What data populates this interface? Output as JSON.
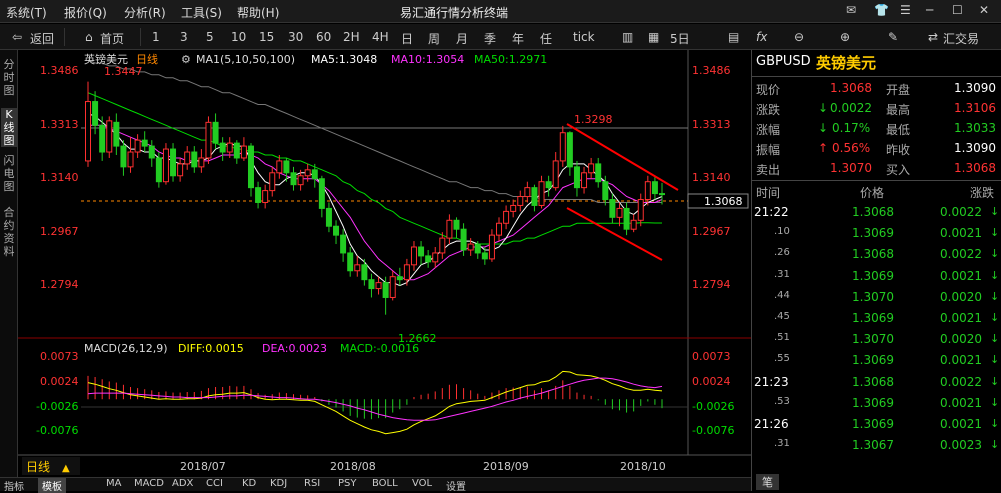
{
  "menu": [
    "系统(T)",
    "报价(Q)",
    "分析(R)",
    "工具(S)",
    "帮助(H)"
  ],
  "window_title": "易汇通行情分析终端",
  "toolbar": {
    "back": "返回",
    "home": "首页",
    "periods": [
      "1",
      "3",
      "5",
      "10",
      "15",
      "30",
      "60",
      "2H",
      "4H",
      "日",
      "周",
      "月",
      "季",
      "年",
      "任",
      "tick"
    ],
    "five_day": "5日",
    "fx": "fx",
    "trade": "汇交易"
  },
  "left_tabs": [
    "分时图",
    "K线图",
    "闪电图",
    "合约资料"
  ],
  "main_legend": {
    "name": "英镑美元",
    "period": "日线",
    "ma_params": "MA1(5,10,50,100)",
    "ma5": "MA5:1.3048",
    "ma10": "MA10:1.3054",
    "ma50": "MA50:1.2971"
  },
  "price_axis": [
    "1.3486",
    "1.3313",
    "1.3140",
    "1.2967",
    "1.2794"
  ],
  "current_price_tag": "1.3068",
  "annotations": {
    "high": "1.3447",
    "low": "1.2662",
    "swing": "1.3298"
  },
  "macd_legend": {
    "name": "MACD(26,12,9)",
    "diff": "DIFF:0.0015",
    "dea": "DEA:0.0023",
    "macd": "MACD:-0.0016"
  },
  "macd_axis": [
    "0.0073",
    "0.0024",
    "-0.0026",
    "-0.0076"
  ],
  "x_labels": [
    "2018/07",
    "2018/08",
    "2018/09",
    "2018/10"
  ],
  "period_badge": "日线",
  "bottom_tabs": [
    "指标",
    "模板",
    "MA",
    "MACD",
    "ADX",
    "CCI",
    "KD",
    "KDJ",
    "RSI",
    "PSY",
    "BOLL",
    "VOL",
    "设置"
  ],
  "colors": {
    "up": "#ff3030",
    "down": "#22cc22",
    "ma5": "#ffffff",
    "ma10": "#ff33ff",
    "ma50": "#00dd00",
    "ma100": "#777777",
    "trend": "#ff0000",
    "price_text": "#ff3333"
  },
  "quote": {
    "symbol": "GBPUSD",
    "name_cn": "英镑美元",
    "rows": [
      {
        "l1": "现价",
        "v1": "1.3068",
        "l2": "开盘",
        "v2": "1.3090"
      },
      {
        "l1": "涨跌",
        "v1": "0.0022",
        "l2": "最高",
        "v2": "1.3106"
      },
      {
        "l1": "涨幅",
        "v1": "0.17%",
        "l2": "最低",
        "v2": "1.3033"
      },
      {
        "l1": "振幅",
        "v1": "0.56%",
        "l2": "昨收",
        "v2": "1.3090"
      },
      {
        "l1": "卖出",
        "v1": "1.3070",
        "l2": "买入",
        "v2": "1.3068"
      }
    ],
    "tick_headers": [
      "时间",
      "价格",
      "涨跌"
    ],
    "ticks": [
      {
        "t": "21:22",
        "p": "1.3068",
        "c": "0.0022"
      },
      {
        "t": ".10",
        "p": "1.3069",
        "c": "0.0021"
      },
      {
        "t": ".26",
        "p": "1.3068",
        "c": "0.0022"
      },
      {
        "t": ".31",
        "p": "1.3069",
        "c": "0.0021"
      },
      {
        "t": ".44",
        "p": "1.3070",
        "c": "0.0020"
      },
      {
        "t": ".45",
        "p": "1.3069",
        "c": "0.0021"
      },
      {
        "t": ".51",
        "p": "1.3070",
        "c": "0.0020"
      },
      {
        "t": ".55",
        "p": "1.3069",
        "c": "0.0021"
      },
      {
        "t": "21:23",
        "p": "1.3068",
        "c": "0.0022"
      },
      {
        "t": ".53",
        "p": "1.3069",
        "c": "0.0021"
      },
      {
        "t": "21:26",
        "p": "1.3069",
        "c": "0.0021"
      },
      {
        "t": ".31",
        "p": "1.3067",
        "c": "0.0023"
      }
    ],
    "footer": "笔"
  },
  "chart_data": {
    "type": "candlestick",
    "instrument": "GBPUSD 英镑美元",
    "period": "日线",
    "x_ticks": [
      "2018/07",
      "2018/08",
      "2018/09",
      "2018/10"
    ],
    "y_ticks": [
      1.2794,
      1.2967,
      1.314,
      1.3313,
      1.3486
    ],
    "ylim": [
      1.257,
      1.352
    ],
    "current_price": 1.3068,
    "high_marker": 1.3447,
    "low_marker": 1.2662,
    "swing_high_marker": 1.3298,
    "candles": [
      [
        1.318,
        1.338,
        1.3447,
        1.316
      ],
      [
        1.338,
        1.33,
        1.3415,
        1.327
      ],
      [
        1.33,
        1.321,
        1.333,
        1.318
      ],
      [
        1.321,
        1.3315,
        1.333,
        1.319
      ],
      [
        1.331,
        1.323,
        1.334,
        1.32
      ],
      [
        1.323,
        1.316,
        1.325,
        1.313
      ],
      [
        1.316,
        1.321,
        1.326,
        1.314
      ],
      [
        1.321,
        1.325,
        1.327,
        1.319
      ],
      [
        1.325,
        1.323,
        1.328,
        1.321
      ],
      [
        1.323,
        1.319,
        1.325,
        1.316
      ],
      [
        1.319,
        1.311,
        1.321,
        1.309
      ],
      [
        1.311,
        1.322,
        1.324,
        1.31
      ],
      [
        1.322,
        1.313,
        1.324,
        1.311
      ],
      [
        1.313,
        1.317,
        1.319,
        1.311
      ],
      [
        1.317,
        1.321,
        1.323,
        1.315
      ],
      [
        1.321,
        1.316,
        1.323,
        1.314
      ],
      [
        1.316,
        1.319,
        1.322,
        1.314
      ],
      [
        1.319,
        1.331,
        1.333,
        1.317
      ],
      [
        1.331,
        1.324,
        1.334,
        1.322
      ],
      [
        1.324,
        1.321,
        1.326,
        1.318
      ],
      [
        1.321,
        1.324,
        1.326,
        1.319
      ],
      [
        1.324,
        1.319,
        1.325,
        1.317
      ],
      [
        1.319,
        1.323,
        1.326,
        1.318
      ],
      [
        1.323,
        1.309,
        1.324,
        1.306
      ],
      [
        1.309,
        1.304,
        1.311,
        1.302
      ],
      [
        1.304,
        1.308,
        1.31,
        1.302
      ],
      [
        1.308,
        1.314,
        1.316,
        1.306
      ],
      [
        1.314,
        1.318,
        1.32,
        1.312
      ],
      [
        1.318,
        1.314,
        1.319,
        1.311
      ],
      [
        1.314,
        1.31,
        1.316,
        1.308
      ],
      [
        1.31,
        1.313,
        1.315,
        1.308
      ],
      [
        1.313,
        1.315,
        1.317,
        1.311
      ],
      [
        1.315,
        1.312,
        1.317,
        1.309
      ],
      [
        1.312,
        1.302,
        1.313,
        1.299
      ],
      [
        1.302,
        1.296,
        1.304,
        1.294
      ],
      [
        1.296,
        1.293,
        1.298,
        1.29
      ],
      [
        1.293,
        1.287,
        1.295,
        1.284
      ],
      [
        1.287,
        1.281,
        1.289,
        1.279
      ],
      [
        1.281,
        1.283,
        1.286,
        1.279
      ],
      [
        1.283,
        1.278,
        1.285,
        1.276
      ],
      [
        1.278,
        1.275,
        1.28,
        1.272
      ],
      [
        1.275,
        1.277,
        1.279,
        1.273
      ],
      [
        1.277,
        1.272,
        1.279,
        1.2662
      ],
      [
        1.272,
        1.279,
        1.281,
        1.271
      ],
      [
        1.279,
        1.278,
        1.282,
        1.276
      ],
      [
        1.278,
        1.283,
        1.285,
        1.276
      ],
      [
        1.283,
        1.289,
        1.291,
        1.281
      ],
      [
        1.289,
        1.286,
        1.291,
        1.283
      ],
      [
        1.286,
        1.284,
        1.288,
        1.282
      ],
      [
        1.284,
        1.287,
        1.289,
        1.282
      ],
      [
        1.287,
        1.292,
        1.294,
        1.285
      ],
      [
        1.292,
        1.298,
        1.3,
        1.29
      ],
      [
        1.298,
        1.295,
        1.299,
        1.292
      ],
      [
        1.295,
        1.288,
        1.297,
        1.286
      ],
      [
        1.288,
        1.29,
        1.292,
        1.286
      ],
      [
        1.29,
        1.287,
        1.291,
        1.285
      ],
      [
        1.287,
        1.285,
        1.289,
        1.283
      ],
      [
        1.285,
        1.293,
        1.295,
        1.284
      ],
      [
        1.293,
        1.297,
        1.299,
        1.291
      ],
      [
        1.297,
        1.301,
        1.303,
        1.295
      ],
      [
        1.301,
        1.303,
        1.305,
        1.299
      ],
      [
        1.303,
        1.306,
        1.308,
        1.301
      ],
      [
        1.306,
        1.309,
        1.311,
        1.304
      ],
      [
        1.309,
        1.303,
        1.31,
        1.301
      ],
      [
        1.303,
        1.311,
        1.313,
        1.302
      ],
      [
        1.311,
        1.309,
        1.313,
        1.306
      ],
      [
        1.309,
        1.318,
        1.321,
        1.308
      ],
      [
        1.318,
        1.3275,
        1.3298,
        1.316
      ],
      [
        1.3275,
        1.316,
        1.328,
        1.313
      ],
      [
        1.316,
        1.309,
        1.318,
        1.306
      ],
      [
        1.309,
        1.314,
        1.316,
        1.307
      ],
      [
        1.314,
        1.317,
        1.319,
        1.312
      ],
      [
        1.317,
        1.311,
        1.319,
        1.309
      ],
      [
        1.311,
        1.305,
        1.313,
        1.303
      ],
      [
        1.305,
        1.299,
        1.307,
        1.297
      ],
      [
        1.299,
        1.302,
        1.304,
        1.296
      ],
      [
        1.302,
        1.295,
        1.304,
        1.293
      ],
      [
        1.295,
        1.298,
        1.3,
        1.294
      ],
      [
        1.298,
        1.305,
        1.307,
        1.296
      ],
      [
        1.305,
        1.311,
        1.313,
        1.303
      ],
      [
        1.311,
        1.307,
        1.313,
        1.305
      ],
      [
        1.307,
        1.3068,
        1.3106,
        1.3033
      ]
    ],
    "ma5": [
      1.334,
      1.333,
      1.331,
      1.329,
      1.327,
      1.324,
      1.322,
      1.322,
      1.321,
      1.321,
      1.319,
      1.319,
      1.318,
      1.317,
      1.317,
      1.318,
      1.318,
      1.319,
      1.322,
      1.323,
      1.324,
      1.323,
      1.323,
      1.318,
      1.314,
      1.311,
      1.31,
      1.31,
      1.312,
      1.313,
      1.314,
      1.314,
      1.313,
      1.31,
      1.306,
      1.301,
      1.296,
      1.29,
      1.286,
      1.284,
      1.281,
      1.279,
      1.277,
      1.277,
      1.276,
      1.277,
      1.28,
      1.283,
      1.284,
      1.286,
      1.288,
      1.29,
      1.291,
      1.291,
      1.291,
      1.29,
      1.288,
      1.288,
      1.289,
      1.292,
      1.296,
      1.3,
      1.303,
      1.305,
      1.307,
      1.308,
      1.311,
      1.315,
      1.317,
      1.317,
      1.317,
      1.315,
      1.313,
      1.311,
      1.307,
      1.304,
      1.301,
      1.3,
      1.302,
      1.304,
      1.305,
      1.306
    ],
    "ma10": [
      1.33,
      1.33,
      1.33,
      1.329,
      1.328,
      1.327,
      1.326,
      1.325,
      1.324,
      1.323,
      1.321,
      1.32,
      1.319,
      1.319,
      1.318,
      1.318,
      1.318,
      1.318,
      1.319,
      1.32,
      1.32,
      1.32,
      1.321,
      1.32,
      1.319,
      1.317,
      1.316,
      1.314,
      1.313,
      1.312,
      1.312,
      1.312,
      1.312,
      1.31,
      1.308,
      1.305,
      1.302,
      1.299,
      1.295,
      1.291,
      1.288,
      1.285,
      1.283,
      1.281,
      1.279,
      1.278,
      1.278,
      1.279,
      1.28,
      1.282,
      1.284,
      1.286,
      1.287,
      1.288,
      1.289,
      1.289,
      1.289,
      1.29,
      1.291,
      1.292,
      1.293,
      1.295,
      1.297,
      1.299,
      1.301,
      1.303,
      1.306,
      1.309,
      1.31,
      1.311,
      1.312,
      1.312,
      1.312,
      1.311,
      1.31,
      1.308,
      1.306,
      1.305,
      1.304,
      1.304,
      1.304,
      1.305
    ],
    "ma50": [
      1.341,
      1.34,
      1.339,
      1.338,
      1.337,
      1.336,
      1.335,
      1.334,
      1.333,
      1.332,
      1.331,
      1.33,
      1.329,
      1.328,
      1.327,
      1.326,
      1.325,
      1.325,
      1.324,
      1.323,
      1.323,
      1.322,
      1.322,
      1.321,
      1.321,
      1.32,
      1.32,
      1.319,
      1.319,
      1.318,
      1.318,
      1.317,
      1.316,
      1.315,
      1.314,
      1.313,
      1.311,
      1.31,
      1.308,
      1.307,
      1.305,
      1.304,
      1.302,
      1.301,
      1.299,
      1.298,
      1.297,
      1.296,
      1.295,
      1.294,
      1.293,
      1.292,
      1.292,
      1.291,
      1.291,
      1.29,
      1.29,
      1.29,
      1.29,
      1.29,
      1.291,
      1.291,
      1.292,
      1.292,
      1.293,
      1.294,
      1.295,
      1.296,
      1.296,
      1.297,
      1.297,
      1.297,
      1.297,
      1.297,
      1.297,
      1.297,
      1.297,
      1.297,
      1.2972,
      1.2972,
      1.2971,
      1.2971
    ],
    "ma100": [
      1.352,
      1.351,
      1.351,
      1.35,
      1.35,
      1.349,
      1.349,
      1.348,
      1.348,
      1.347,
      1.347,
      1.346,
      1.346,
      1.345,
      1.345,
      1.344,
      1.343,
      1.343,
      1.342,
      1.341,
      1.341,
      1.34,
      1.339,
      1.338,
      1.337,
      1.337,
      1.336,
      1.335,
      1.334,
      1.333,
      1.332,
      1.331,
      1.33,
      1.329,
      1.328,
      1.327,
      1.326,
      1.325,
      1.324,
      1.323,
      1.322,
      1.321,
      1.32,
      1.319,
      1.318,
      1.317,
      1.316,
      1.315,
      1.314,
      1.313,
      1.312,
      1.311,
      1.311,
      1.31,
      1.309,
      1.309,
      1.308,
      1.308,
      1.307,
      1.307,
      1.306,
      1.306,
      1.306,
      1.306,
      1.305,
      1.305,
      1.305,
      1.305,
      1.305,
      1.305,
      1.305,
      1.305,
      1.304,
      1.304,
      1.304,
      1.304,
      1.304,
      1.304,
      1.304,
      1.304,
      1.304,
      1.304
    ],
    "macd_ylim": [
      -0.0095,
      0.0085
    ],
    "macd_hist": [
      0.0042,
      0.004,
      0.0036,
      0.0032,
      0.003,
      0.0026,
      0.0022,
      0.002,
      0.0018,
      0.0016,
      0.0013,
      0.0014,
      0.0012,
      0.0012,
      0.0013,
      0.0013,
      0.0015,
      0.002,
      0.0022,
      0.0022,
      0.0024,
      0.0023,
      0.0024,
      0.0018,
      0.0011,
      0.0008,
      0.0009,
      0.0012,
      0.0011,
      0.0009,
      0.0008,
      0.0007,
      0.0004,
      -0.0004,
      -0.001,
      -0.0015,
      -0.0022,
      -0.003,
      -0.0033,
      -0.0035,
      -0.0036,
      -0.0034,
      -0.0034,
      -0.0024,
      -0.0018,
      -0.001,
      0.0004,
      0.0008,
      0.001,
      0.0014,
      0.002,
      0.0026,
      0.0027,
      0.002,
      0.0016,
      0.001,
      0.0006,
      0.0012,
      0.0016,
      0.002,
      0.0021,
      0.0022,
      0.0023,
      0.0016,
      0.002,
      0.0016,
      0.0024,
      0.0034,
      0.0024,
      0.0012,
      0.0008,
      0.0006,
      -0.0002,
      -0.001,
      -0.0018,
      -0.002,
      -0.0024,
      -0.0022,
      -0.0012,
      -0.0004,
      -0.001,
      -0.0016
    ],
    "diff": [
      0.003,
      0.0027,
      0.0023,
      0.0019,
      0.0016,
      0.0012,
      0.0008,
      0.0006,
      0.0004,
      0.0002,
      0.0,
      0.0001,
      0.0,
      0.0,
      0.0001,
      0.0001,
      0.0002,
      0.0006,
      0.0008,
      0.0009,
      0.0011,
      0.0011,
      0.0012,
      0.0008,
      0.0003,
      0.0,
      -0.0001,
      0.0,
      0.0,
      -0.0001,
      -0.0002,
      -0.0002,
      -0.0004,
      -0.001,
      -0.0016,
      -0.0022,
      -0.003,
      -0.0038,
      -0.0044,
      -0.005,
      -0.0055,
      -0.0058,
      -0.0062,
      -0.006,
      -0.0058,
      -0.0054,
      -0.0046,
      -0.004,
      -0.0035,
      -0.003,
      -0.0022,
      -0.0013,
      -0.0008,
      -0.0006,
      -0.0004,
      -0.0003,
      -0.0002,
      0.0003,
      0.0008,
      0.0013,
      0.0017,
      0.0021,
      0.0025,
      0.0026,
      0.0031,
      0.0033,
      0.004,
      0.005,
      0.0049,
      0.0044,
      0.0043,
      0.0042,
      0.0039,
      0.0034,
      0.0028,
      0.0024,
      0.0019,
      0.0016,
      0.0016,
      0.0018,
      0.0016,
      0.0015
    ],
    "dea": [
      0.001,
      0.0011,
      0.0011,
      0.0011,
      0.0011,
      0.0011,
      0.001,
      0.0009,
      0.0008,
      0.0007,
      0.0006,
      0.0005,
      0.0004,
      0.0004,
      0.0003,
      0.0003,
      0.0003,
      0.0003,
      0.0004,
      0.0005,
      0.0006,
      0.0006,
      0.0007,
      0.0007,
      0.0006,
      0.0005,
      0.0004,
      0.0003,
      0.0003,
      0.0002,
      0.0001,
      0.0,
      0.0,
      -0.0002,
      -0.0004,
      -0.0006,
      -0.0009,
      -0.0012,
      -0.0016,
      -0.0019,
      -0.0023,
      -0.0027,
      -0.003,
      -0.0033,
      -0.0035,
      -0.0037,
      -0.0038,
      -0.0038,
      -0.0038,
      -0.0037,
      -0.0034,
      -0.0031,
      -0.0028,
      -0.0025,
      -0.0022,
      -0.0019,
      -0.0016,
      -0.0013,
      -0.0009,
      -0.0005,
      -0.0002,
      0.0002,
      0.0005,
      0.0008,
      0.0011,
      0.0015,
      0.0019,
      0.0023,
      0.0027,
      0.0031,
      0.0034,
      0.0036,
      0.0038,
      0.0038,
      0.0037,
      0.0034,
      0.0031,
      0.0027,
      0.0024,
      0.0022,
      0.0021,
      0.0023
    ]
  }
}
